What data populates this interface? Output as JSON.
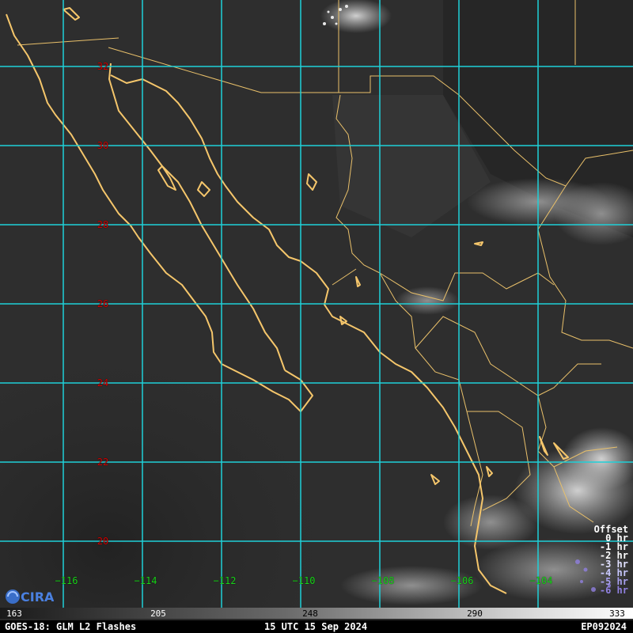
{
  "latitudes": [
    {
      "label": "32",
      "value": 32
    },
    {
      "label": "30",
      "value": 30
    },
    {
      "label": "28",
      "value": 28
    },
    {
      "label": "26",
      "value": 26
    },
    {
      "label": "24",
      "value": 24
    },
    {
      "label": "22",
      "value": 22
    },
    {
      "label": "20",
      "value": 20
    }
  ],
  "longitudes": [
    {
      "label": "−116",
      "value": -116
    },
    {
      "label": "−114",
      "value": -114
    },
    {
      "label": "−112",
      "value": -112
    },
    {
      "label": "−110",
      "value": -110
    },
    {
      "label": "−108",
      "value": -108
    },
    {
      "label": "−106",
      "value": -106
    },
    {
      "label": "−104",
      "value": -104
    }
  ],
  "offset_legend": {
    "title": "Offset",
    "items": [
      {
        "label": "0 hr",
        "color": "#ffffff"
      },
      {
        "label": "-1 hr",
        "color": "#ffffff"
      },
      {
        "label": "-2 hr",
        "color": "#ffffff"
      },
      {
        "label": "-3 hr",
        "color": "#e0e0ff"
      },
      {
        "label": "-4 hr",
        "color": "#c8c8ff"
      },
      {
        "label": "-5 hr",
        "color": "#a8a0f0"
      },
      {
        "label": "-6 hr",
        "color": "#9080e0"
      }
    ]
  },
  "colorbar": {
    "ticks": [
      "163",
      "205",
      "248",
      "290",
      "333"
    ]
  },
  "footer": {
    "product": "GOES-18: GLM L2 Flashes",
    "time": "15 UTC 15 Sep 2024",
    "storm_id": "EP092024"
  },
  "logo": {
    "text": "CIRA"
  },
  "colors": {
    "gridline": "#1fd0d8",
    "coastline": "#f5c66b",
    "lat_label": "#d00000",
    "lon_label": "#19d419"
  }
}
